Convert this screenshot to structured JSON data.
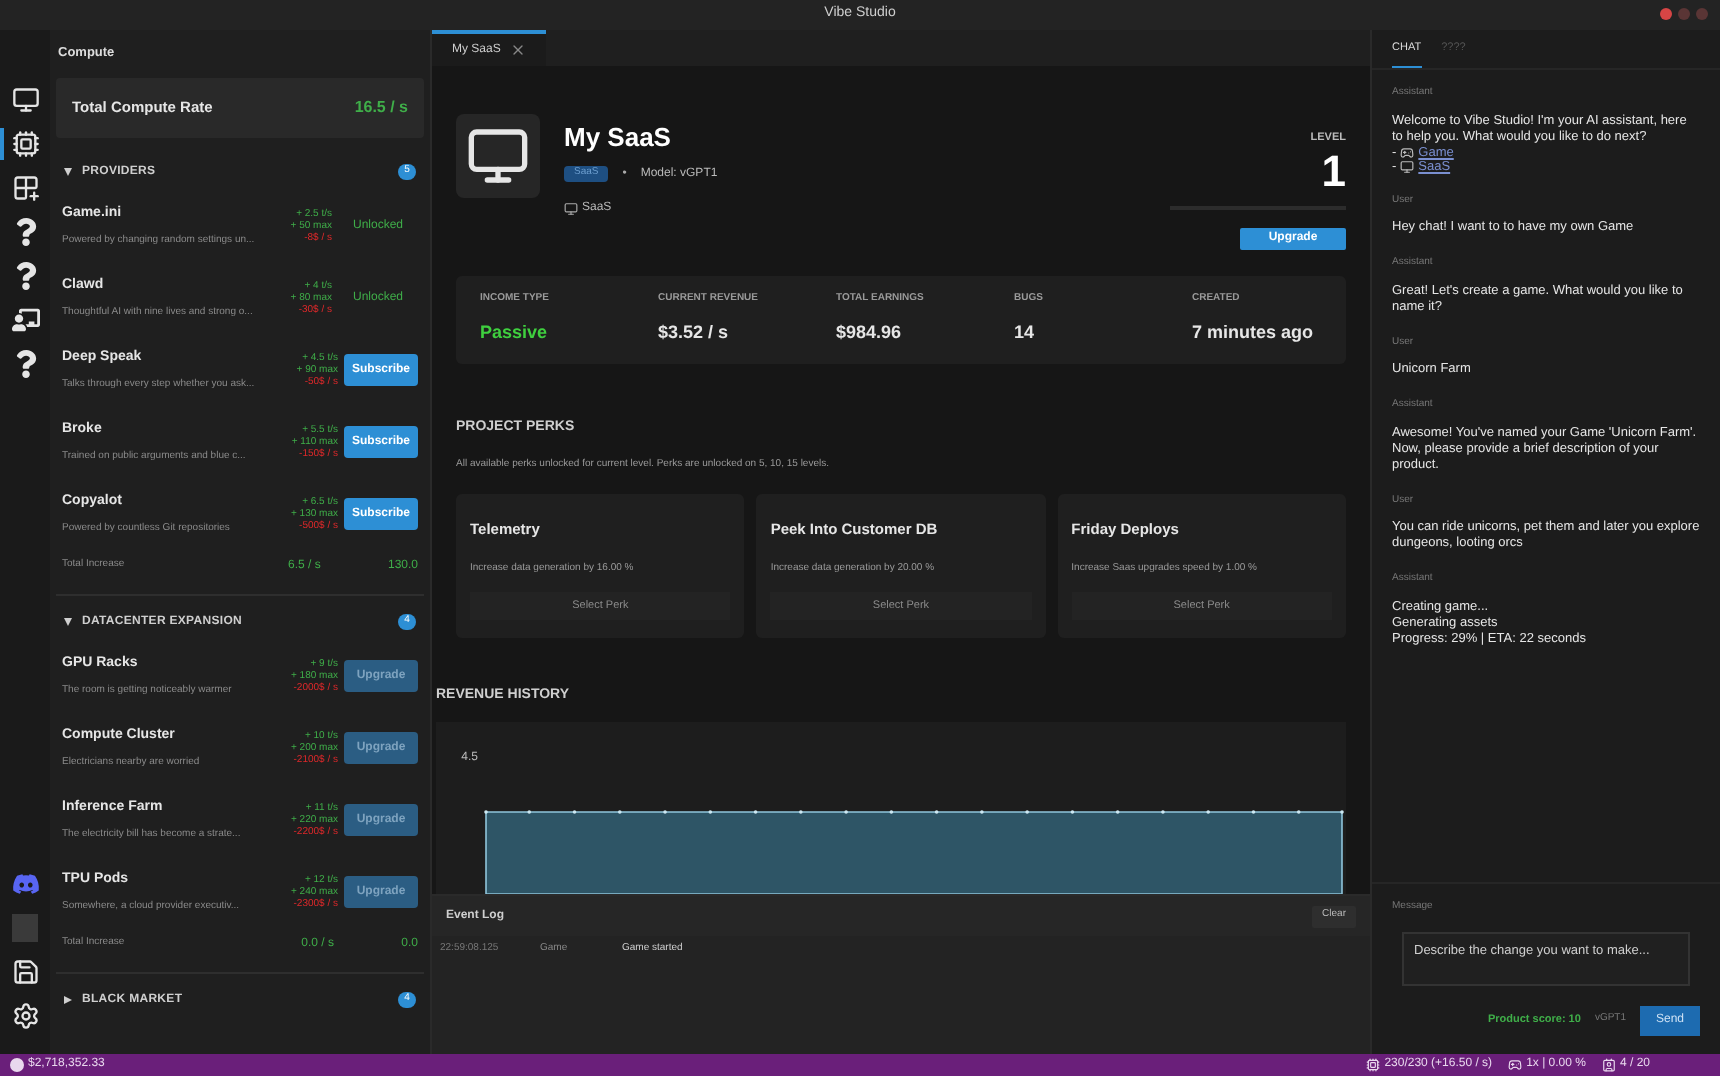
{
  "window": {
    "title": "Vibe Studio"
  },
  "rail": {
    "top": [
      {
        "kind": "monitor",
        "selected": false
      },
      {
        "kind": "chip",
        "selected": true
      },
      {
        "kind": "grid",
        "selected": false
      },
      {
        "kind": "question",
        "selected": false
      },
      {
        "kind": "question",
        "selected": false
      },
      {
        "kind": "desk",
        "selected": false
      },
      {
        "kind": "question",
        "selected": false
      }
    ],
    "bottom": [
      {
        "kind": "chat"
      },
      {
        "kind": "avatar"
      },
      {
        "kind": "save"
      },
      {
        "kind": "settings"
      }
    ]
  },
  "left_panel": {
    "title": "Compute",
    "total_rate": {
      "label": "Total Compute Rate",
      "value": "16.5 / s"
    },
    "sections": [
      {
        "title": "PROVIDERS",
        "count": "5",
        "expanded": true,
        "items": [
          {
            "name": "Game.ini",
            "description": "Powered by changing random settings un...",
            "rates": [
              "+ 2.5 t/s",
              "+ 50 max",
              "-8$ / s"
            ],
            "action": {
              "kind": "status",
              "label": "Unlocked"
            }
          },
          {
            "name": "Clawd",
            "description": "Thoughtful AI with nine lives and strong o...",
            "rates": [
              "+ 4 t/s",
              "+ 80 max",
              "-30$ / s"
            ],
            "action": {
              "kind": "status",
              "label": "Unlocked"
            }
          },
          {
            "name": "Deep Speak",
            "description": "Talks through every step whether you ask...",
            "rates": [
              "+ 4.5 t/s",
              "+ 90 max",
              "-50$ / s"
            ],
            "action": {
              "kind": "button",
              "label": "Subscribe",
              "disabled": false
            }
          },
          {
            "name": "Broke",
            "description": "Trained on public arguments and blue c...",
            "rates": [
              "+ 5.5 t/s",
              "+ 110 max",
              "-150$ / s"
            ],
            "action": {
              "kind": "button",
              "label": "Subscribe",
              "disabled": false
            }
          },
          {
            "name": "Copyalot",
            "description": "Powered by countless Git repositories",
            "rates": [
              "+ 6.5 t/s",
              "+ 130 max",
              "-500$ / s"
            ],
            "action": {
              "kind": "button",
              "label": "Subscribe",
              "disabled": false
            }
          }
        ],
        "total": {
          "label": "Total Increase",
          "rate": "6.5 / s",
          "max": "130.0"
        }
      },
      {
        "title": "DATACENTER EXPANSION",
        "count": "4",
        "expanded": true,
        "items": [
          {
            "name": "GPU Racks",
            "description": "The room is getting noticeably warmer",
            "rates": [
              "+ 9 t/s",
              "+ 180 max",
              "-2000$ / s"
            ],
            "action": {
              "kind": "button",
              "label": "Upgrade",
              "disabled": true
            }
          },
          {
            "name": "Compute Cluster",
            "description": "Electricians nearby are worried",
            "rates": [
              "+ 10 t/s",
              "+ 200 max",
              "-2100$ / s"
            ],
            "action": {
              "kind": "button",
              "label": "Upgrade",
              "disabled": true
            }
          },
          {
            "name": "Inference Farm",
            "description": "The electricity bill has become a strate...",
            "rates": [
              "+ 11 t/s",
              "+ 220 max",
              "-2200$ / s"
            ],
            "action": {
              "kind": "button",
              "label": "Upgrade",
              "disabled": true
            }
          },
          {
            "name": "TPU Pods",
            "description": "Somewhere, a cloud provider executiv...",
            "rates": [
              "+ 12 t/s",
              "+ 240 max",
              "-2300$ / s"
            ],
            "action": {
              "kind": "button",
              "label": "Upgrade",
              "disabled": true
            }
          }
        ],
        "total": {
          "label": "Total Increase",
          "rate": "0.0 / s",
          "max": "0.0"
        }
      },
      {
        "title": "BLACK MARKET",
        "count": "4",
        "expanded": false
      }
    ]
  },
  "tabs": [
    {
      "label": "My SaaS",
      "selected": true
    }
  ],
  "project": {
    "title": "My SaaS",
    "badge": "SaaS",
    "separator": "•",
    "model": "Model: vGPT1",
    "category": "SaaS",
    "level_label": "LEVEL",
    "level_value": "1",
    "upgrade": "Upgrade"
  },
  "stats": [
    {
      "label": "INCOME TYPE",
      "value": "Passive",
      "kind": "positive"
    },
    {
      "label": "CURRENT REVENUE",
      "value": "$3.52 / s",
      "kind": "plain"
    },
    {
      "label": "TOTAL EARNINGS",
      "value": "$984.96",
      "kind": "plain"
    },
    {
      "label": "BUGS",
      "value": "14",
      "kind": "plain"
    },
    {
      "label": "CREATED",
      "value": "7 minutes ago",
      "kind": "plain"
    }
  ],
  "perks": {
    "title": "PROJECT PERKS",
    "note": "All available perks unlocked for current level. Perks are unlocked on 5, 10, 15 levels.",
    "items": [
      {
        "name": "Telemetry",
        "description": "Increase data generation by 16.00 %",
        "button": "Select Perk"
      },
      {
        "name": "Peek Into Customer DB",
        "description": "Increase data generation by 20.00 %",
        "button": "Select Perk"
      },
      {
        "name": "Friday Deploys",
        "description": "Increase Saas upgrades speed by 1.00 %",
        "button": "Select Perk"
      }
    ]
  },
  "revenue": {
    "title": "REVENUE HISTORY",
    "y_tick": "4.5"
  },
  "event_log": {
    "title": "Event Log",
    "clear": "Clear",
    "rows": [
      {
        "time": "22:59:08.125",
        "source": "Game",
        "message": "Game started"
      }
    ]
  },
  "chat": {
    "tabs": [
      {
        "label": "CHAT",
        "selected": true
      },
      {
        "label": "????",
        "selected": false
      }
    ],
    "messages": [
      {
        "role": "Assistant",
        "lines": [
          "Welcome to Vibe Studio! I'm your AI assistant, here to help you. What would you like to do next?"
        ],
        "links": [
          {
            "bullet": "-",
            "kind": "game",
            "label": "Game"
          },
          {
            "bullet": "-",
            "kind": "saas",
            "label": "SaaS"
          }
        ]
      },
      {
        "role": "User",
        "lines": [
          "Hey chat! I want to to have my own Game"
        ]
      },
      {
        "role": "Assistant",
        "lines": [
          "Great! Let's create a game. What would you like to name it?"
        ]
      },
      {
        "role": "User",
        "lines": [
          "Unicorn Farm"
        ]
      },
      {
        "role": "Assistant",
        "lines": [
          "Awesome! You've named your Game 'Unicorn Farm'. Now, please provide a brief description of your product."
        ]
      },
      {
        "role": "User",
        "lines": [
          "You can ride unicorns, pet them and later you explore dungeons, looting orcs"
        ]
      },
      {
        "role": "Assistant",
        "lines": [
          "Creating game...",
          "Generating assets",
          "Progress: 29% | ETA: 22 seconds"
        ]
      }
    ],
    "composer": {
      "label": "Message",
      "placeholder": "Describe the change you want to make...",
      "score": "Product score: 10",
      "model": "vGPT1",
      "send": "Send"
    }
  },
  "status_bar": {
    "money": "$2,718,352.33",
    "compute": "230/230 (+16.50 / s)",
    "speed": "1x | 0.00 %",
    "slots": "4 / 20"
  }
}
